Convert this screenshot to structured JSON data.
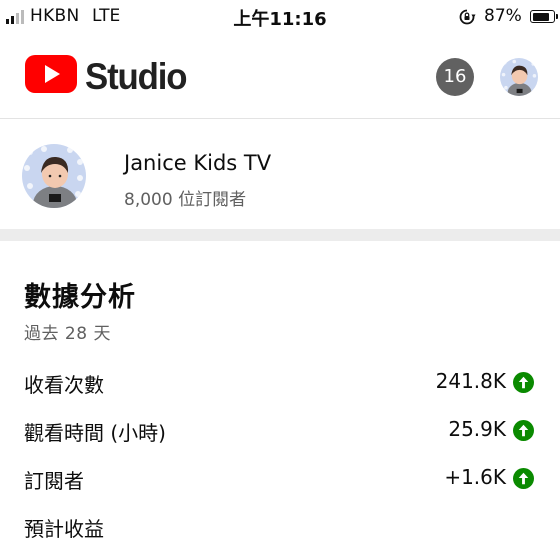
{
  "status_bar": {
    "carrier": "HKBN",
    "network": "LTE",
    "time": "上午11:16",
    "battery": "87%",
    "battery_level": 0.87
  },
  "header": {
    "logo_text": "Studio",
    "notification_count": "16",
    "brand_color": "#ff0000"
  },
  "channel": {
    "name": "Janice Kids TV",
    "subscribers": "8,000 位訂閱者"
  },
  "analytics": {
    "title": "數據分析",
    "period": "過去 28 天",
    "metrics": [
      {
        "label": "收看次數",
        "value": "241.8K",
        "trend": "up-arrow-icon"
      },
      {
        "label": "觀看時間 (小時)",
        "value": "25.9K",
        "trend": "up-arrow-icon"
      },
      {
        "label": "訂閱者",
        "value": "+1.6K",
        "trend": "up-arrow-icon"
      },
      {
        "label": "預計收益",
        "value": "",
        "trend": ""
      }
    ],
    "trend_color": "#0a8a00"
  }
}
